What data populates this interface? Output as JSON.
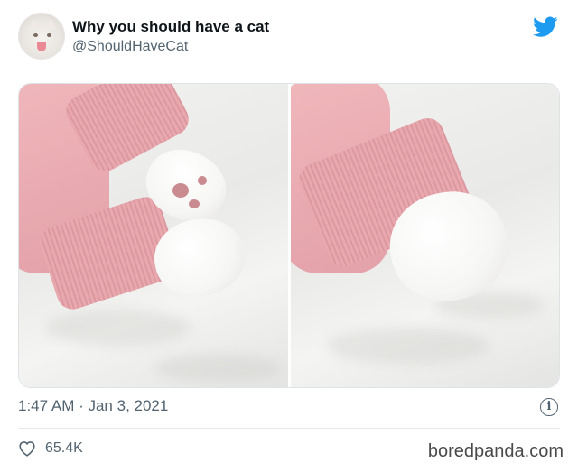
{
  "tweet": {
    "display_name": "Why you should have a cat",
    "handle": "@ShouldHaveCat",
    "timestamp": "1:47 AM · Jan 3, 2021",
    "like_count": "65.4K",
    "info_label": "i"
  },
  "icons": {
    "avatar": "cat-avatar",
    "platform": "twitter-bird-icon",
    "info": "info-icon",
    "like": "heart-icon"
  },
  "colors": {
    "twitter_blue": "#1d9bf0",
    "secondary_text": "#536471",
    "sweater_pink": "#e8a8ae"
  },
  "watermark": "boredpanda.com"
}
